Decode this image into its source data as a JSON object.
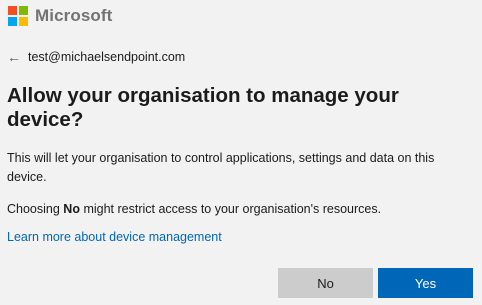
{
  "brand": {
    "name": "Microsoft",
    "logo_colors": [
      "#f25022",
      "#7fba00",
      "#00a4ef",
      "#ffb900"
    ]
  },
  "identity": {
    "back_icon": "left-arrow",
    "email": "test@michaelsendpoint.com"
  },
  "title": "Allow your organisation to manage your device?",
  "paragraph1": "This will let your organisation to control applications, settings and data on this device.",
  "paragraph2": {
    "prefix": "Choosing ",
    "bold": "No",
    "suffix": " might restrict access to your organisation's resources."
  },
  "learn_more_link": "Learn more about device management",
  "buttons": {
    "no_label": "No",
    "yes_label": "Yes"
  },
  "colors": {
    "accent": "#0067b8",
    "secondary_button": "#cccccc",
    "background": "#f2f2f2"
  }
}
